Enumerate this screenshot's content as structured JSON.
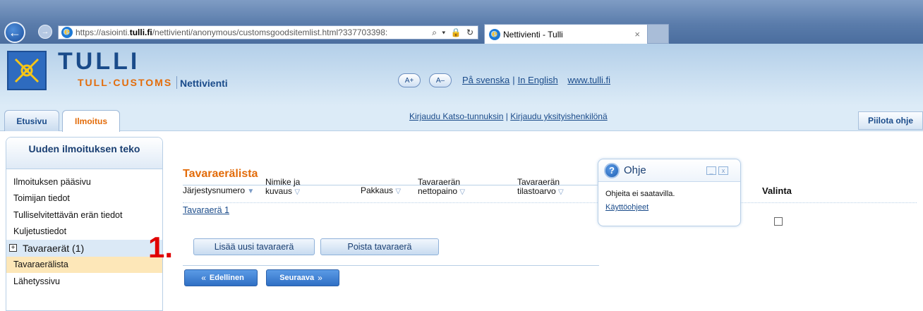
{
  "browser": {
    "url_prefix": "https://asiointi.",
    "url_domain": "tulli.fi",
    "url_path": "/nettivienti/anonymous/customsgoodsitemlist.html?337703398:",
    "addr_tools": "⌕ ▾ 🔒 ↻",
    "tab_title": "Nettivienti - Tulli",
    "tab_close": "×"
  },
  "header": {
    "logo_title": "TULLI",
    "logo_sub": "TULL·CUSTOMS",
    "app_name": "Nettivienti",
    "font_up": "A+",
    "font_down": "A–",
    "lang_sv": "På svenska",
    "lang_sep": "|",
    "lang_en": "In English",
    "site_link": "www.tulli.fi"
  },
  "tabs": {
    "etusivu": "Etusivu",
    "ilmoitus": "Ilmoitus",
    "login_katso": "Kirjaudu Katso-tunnuksin",
    "login_sep": "|",
    "login_private": "Kirjaudu yksityishenkilönä",
    "hide_help": "Piilota ohje"
  },
  "sidebar": {
    "heading": "Uuden ilmoituksen teko",
    "items": [
      {
        "label": "Ilmoituksen pääsivu"
      },
      {
        "label": "Toimijan tiedot"
      },
      {
        "label": "Tulliselvitettävän erän tiedot"
      },
      {
        "label": "Kuljetustiedot"
      },
      {
        "label": "Tavaraerät (1)"
      },
      {
        "label": "Tavaraerälista"
      },
      {
        "label": "Lähetyssivu"
      }
    ]
  },
  "annotation": {
    "step_marker": "1."
  },
  "main": {
    "title": "Tavaraerälista",
    "columns": {
      "c1": "Järjestysnumero",
      "c2a": "Nimike ja",
      "c2b": "kuvaus",
      "c3": "Pakkaus",
      "c4a": "Tavaraerän",
      "c4b": "nettopaino",
      "c5a": "Tavaraerän",
      "c5b": "tilastoarvo",
      "c6": "Valinta"
    },
    "rows": [
      {
        "label": "Tavaraerä 1",
        "selected": false
      }
    ],
    "add_button": "Lisää uusi tavaraerä",
    "remove_button": "Poista tavaraerä",
    "prev_button": "Edellinen",
    "next_button": "Seuraava"
  },
  "help": {
    "title": "Ohje",
    "text": "Ohjeita ei saatavilla.",
    "link": "Käyttöohjeet"
  },
  "colors": {
    "accent_orange": "#e36c0a",
    "brand_blue": "#1a4b8a",
    "active_item": "#fde7b8",
    "marker_red": "#e00000"
  }
}
